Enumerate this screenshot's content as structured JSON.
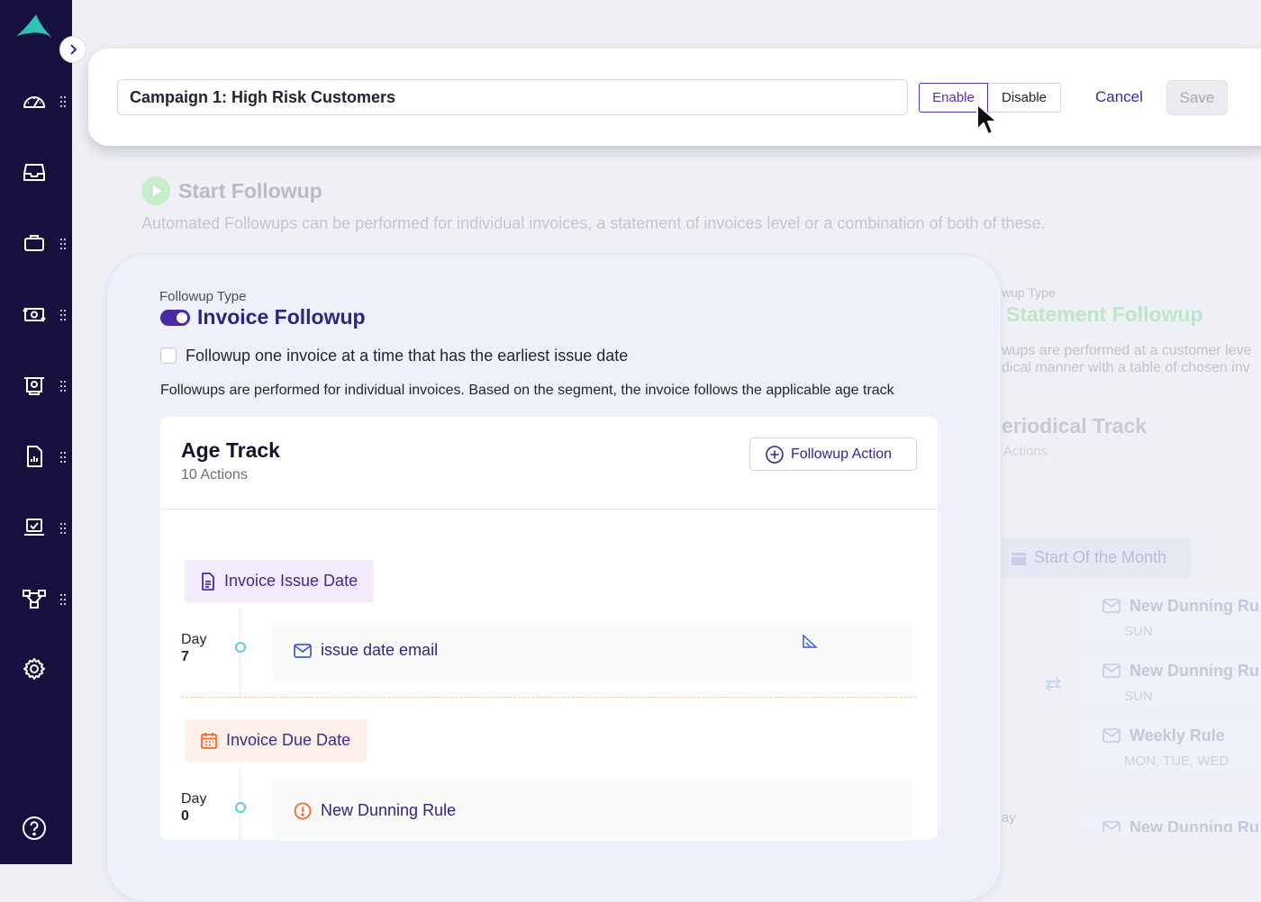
{
  "header": {
    "campaign_title": "Campaign 1: High Risk Customers",
    "enable_label": "Enable",
    "disable_label": "Disable",
    "cancel_label": "Cancel",
    "save_label": "Save"
  },
  "start_followup": {
    "title": "Start Followup",
    "description": "Automated Followups can be performed for individual invoices, a statement of invoices level or a combination of both of these."
  },
  "invoice_followup": {
    "type_label": "Followup Type",
    "title": "Invoice Followup",
    "checkbox_label": "Followup one invoice at a time that has the earliest issue date",
    "note": "Followups are performed for individual invoices. Based on the segment, the invoice follows the applicable age track",
    "age_track": {
      "title": "Age Track",
      "subtitle": "10 Actions",
      "action_button": "Followup Action",
      "groups": [
        {
          "label": "Invoice Issue Date",
          "day_word": "Day",
          "day_num": "7",
          "action": "issue date email"
        },
        {
          "label": "Invoice Due Date",
          "day_word": "Day",
          "day_num": "0",
          "action": "New Dunning Rule"
        }
      ]
    }
  },
  "statement_followup": {
    "type_label_partial": "wup Type",
    "title": "Statement Followup",
    "desc_line1": "wups are performed at a customer leve",
    "desc_line2": "dical manner with a table of chosen inv",
    "track_title": "eriodical Track",
    "track_sub": "Actions",
    "schedule_label": "Start Of the Month",
    "rules": [
      {
        "name": "New Dunning Ru",
        "days": "SUN"
      },
      {
        "name": "New Dunning Ru",
        "days": "SUN"
      },
      {
        "name": "Weekly Rule",
        "days": "MON, TUE, WED"
      },
      {
        "name": "New Dunning Ru",
        "days": ""
      }
    ],
    "day_partial": "ay"
  },
  "colors": {
    "sidebar": "#15103d",
    "accent": "#4b2aa3",
    "brand_teal": "#2fc3b5",
    "link": "#2c2489"
  }
}
